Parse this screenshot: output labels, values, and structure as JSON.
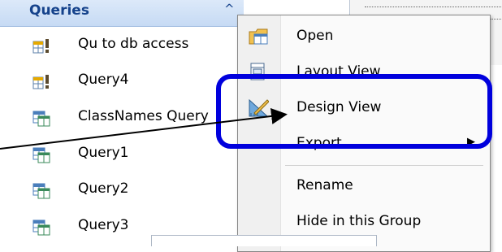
{
  "nav": {
    "title": "Queries",
    "items": [
      {
        "label": "Qu  to db access",
        "icon": "action-query-icon"
      },
      {
        "label": "Query4",
        "icon": "action-query-icon"
      },
      {
        "label": "ClassNames Query",
        "icon": "select-query-icon"
      },
      {
        "label": "Query1",
        "icon": "select-query-icon"
      },
      {
        "label": "Query2",
        "icon": "select-query-icon"
      },
      {
        "label": "Query3",
        "icon": "select-query-icon"
      }
    ]
  },
  "context_menu": {
    "items": [
      {
        "label": "Open",
        "icon": "open-icon"
      },
      {
        "label": "Layout View",
        "icon": "layout-view-icon"
      },
      {
        "label": "Design View",
        "icon": "design-view-icon"
      },
      {
        "label": "Export",
        "icon": "",
        "submenu": true
      },
      {
        "label": "Rename",
        "icon": ""
      },
      {
        "label": "Hide in this Group",
        "icon": ""
      }
    ]
  },
  "colors": {
    "highlight": "#0000dd",
    "nav_header_text": "#15428b",
    "nav_header_bg": "#c6daf4"
  }
}
